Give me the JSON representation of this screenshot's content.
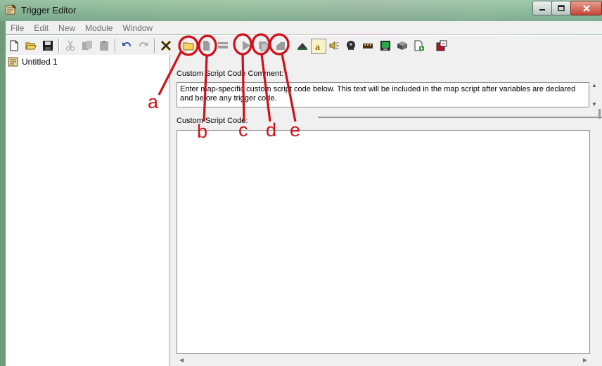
{
  "window": {
    "title": "Trigger Editor",
    "buttons": [
      "minimize",
      "maximize",
      "close"
    ]
  },
  "menu": [
    "File",
    "Edit",
    "New",
    "Module",
    "Window"
  ],
  "toolbar": {
    "icons": [
      "new-document-icon",
      "open-folder-icon",
      "save-disk-icon",
      "cut-icon",
      "copy-icon",
      "paste-icon",
      "undo-icon",
      "redo-icon",
      "trigger-x-icon",
      "new-category-icon",
      "new-trigger-icon",
      "new-comment-icon",
      "new-variable-icon",
      "new-event-icon",
      "new-condition-icon",
      "terrain-editor-icon",
      "text-icon",
      "sound-editor-icon",
      "object-editor-icon",
      "campaign-editor-icon",
      "ai-editor-icon",
      "import-manager-icon",
      "object-manager-icon",
      "test-map-icon"
    ]
  },
  "tree": {
    "items": [
      {
        "label": "Untitled 1"
      }
    ]
  },
  "main": {
    "comment_label": "Custom Script Code Comment:",
    "comment_text": "Enter map-specific custom script code below.  This text will be included in the map script after variables are declared and before any trigger code.",
    "code_label": "Custom Script Code:"
  },
  "annotations": [
    "a",
    "b",
    "c",
    "d",
    "e"
  ],
  "colors": {
    "annotation": "#d0101a",
    "window_bg": "#f0f0f0",
    "disabled_text": "#6d6d6d"
  }
}
